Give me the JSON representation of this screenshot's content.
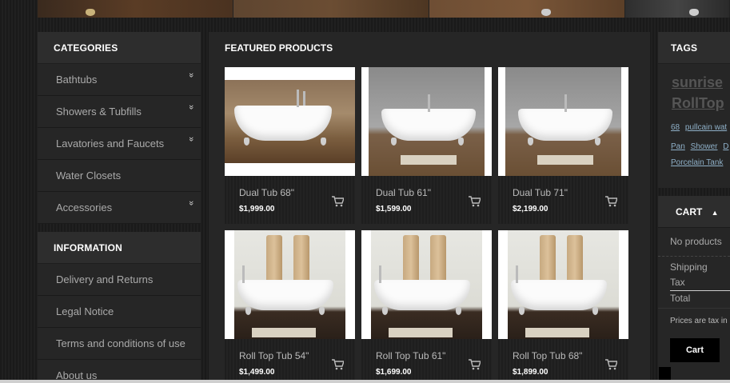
{
  "categories": {
    "title": "CATEGORIES",
    "items": [
      {
        "label": "Bathtubs",
        "expandable": true
      },
      {
        "label": "Showers & Tubfills",
        "expandable": true
      },
      {
        "label": "Lavatories and Faucets",
        "expandable": true
      },
      {
        "label": "Water Closets",
        "expandable": false
      },
      {
        "label": "Accessories",
        "expandable": true
      }
    ],
    "expand_glyph": "»"
  },
  "information": {
    "title": "INFORMATION",
    "items": [
      {
        "label": "Delivery and Returns"
      },
      {
        "label": "Legal Notice"
      },
      {
        "label": "Terms and conditions of use"
      },
      {
        "label": "About us"
      }
    ]
  },
  "featured": {
    "title": "FEATURED PRODUCTS",
    "products": [
      {
        "name": "Dual Tub 68\"",
        "price": "$1,999.00",
        "image": "clawfoot-tub-wood-floor"
      },
      {
        "name": "Dual Tub 61\"",
        "price": "$1,599.00",
        "image": "clawfoot-tub-grey-wall"
      },
      {
        "name": "Dual Tub 71\"",
        "price": "$2,199.00",
        "image": "clawfoot-tub-grey-wall"
      },
      {
        "name": "Roll Top Tub 54\"",
        "price": "$1,499.00",
        "image": "rolltop-tub-towels"
      },
      {
        "name": "Roll Top Tub 61\"",
        "price": "$1,699.00",
        "image": "rolltop-tub-towels"
      },
      {
        "name": "Roll Top Tub 68\"",
        "price": "$1,899.00",
        "image": "rolltop-tub-towels"
      }
    ]
  },
  "tags": {
    "title": "TAGS",
    "big": [
      "sunrise",
      "RollTop"
    ],
    "small_line": [
      "68",
      "pullcain wat"
    ],
    "row1": [
      "Pan",
      "Shower",
      "D"
    ],
    "row2": [
      "Porcelain Tank"
    ]
  },
  "cart": {
    "title": "CART",
    "collapse_icon": "caret-up-icon",
    "no_products": "No products",
    "shipping": "Shipping",
    "tax": "Tax",
    "total": "Total",
    "tax_note": "Prices are tax in",
    "button": "Cart"
  }
}
